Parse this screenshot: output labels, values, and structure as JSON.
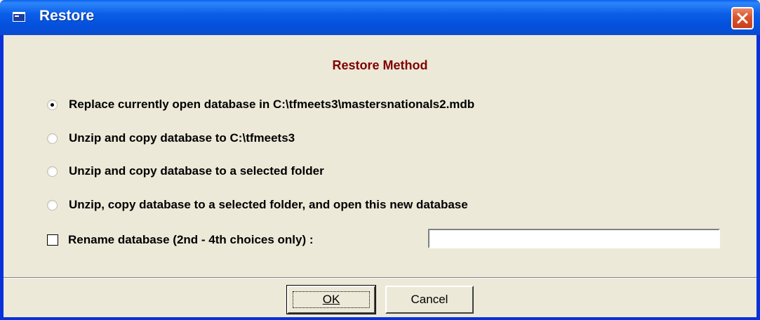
{
  "window": {
    "title": "Restore",
    "close_icon": "close-icon",
    "app_icon": "window-icon"
  },
  "section_title": "Restore Method",
  "options": [
    {
      "label": "Replace currently open database in C:\\tfmeets3\\mastersnationals2.mdb",
      "selected": true
    },
    {
      "label": "Unzip and copy database to C:\\tfmeets3",
      "selected": false
    },
    {
      "label": "Unzip and copy database to a selected folder",
      "selected": false
    },
    {
      "label": "Unzip, copy database to a selected folder, and open this new database",
      "selected": false
    }
  ],
  "rename": {
    "label": "Rename database (2nd - 4th choices only) :",
    "checked": false,
    "value": ""
  },
  "buttons": {
    "ok": "OK",
    "cancel": "Cancel"
  },
  "colors": {
    "titlebar": "#0A5FEF",
    "section_title": "#800000",
    "dialog_bg": "#ECE9D8"
  }
}
